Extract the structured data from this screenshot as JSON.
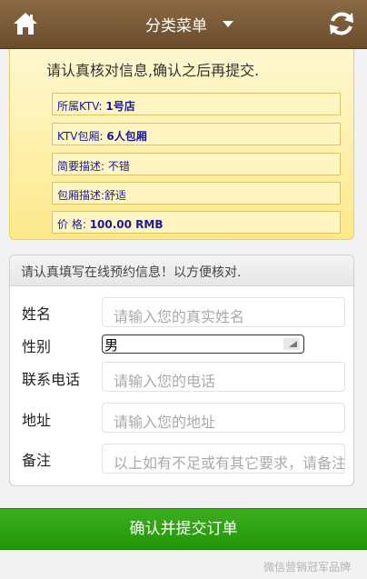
{
  "header": {
    "menu_title": "分类菜单",
    "home_icon": "home-icon",
    "refresh_icon": "refresh-icon",
    "colors": {
      "bar": "#7a5a37",
      "text": "#ffffff"
    }
  },
  "confirm": {
    "heading": "请认真核对信息,确认之后再提交.",
    "rows": [
      {
        "label": "所属KTV: ",
        "value": "1号店"
      },
      {
        "label": "KTV包厢: ",
        "value": "6人包厢"
      },
      {
        "label": "简要描述: ",
        "value": "不错"
      },
      {
        "label": "包厢描述:",
        "value": "舒适"
      },
      {
        "label": "价 格: ",
        "value": "100.00 RMB"
      }
    ]
  },
  "form": {
    "header": "请认真填写在线预约信息！以方便核对.",
    "name": {
      "label": "姓名",
      "placeholder": "请输入您的真实姓名"
    },
    "gender": {
      "label": "性别",
      "selected": "男"
    },
    "phone": {
      "label": "联系电话",
      "placeholder": "请输入您的电话"
    },
    "address": {
      "label": "地址",
      "placeholder": "请输入您的地址"
    },
    "remark": {
      "label": "备注",
      "placeholder": "以上如有不足或有其它要求，请备注"
    }
  },
  "submit": {
    "label": "确认并提交订单",
    "color": "#2ea313"
  },
  "watermark": {
    "text": "微信营销冠军品牌"
  }
}
